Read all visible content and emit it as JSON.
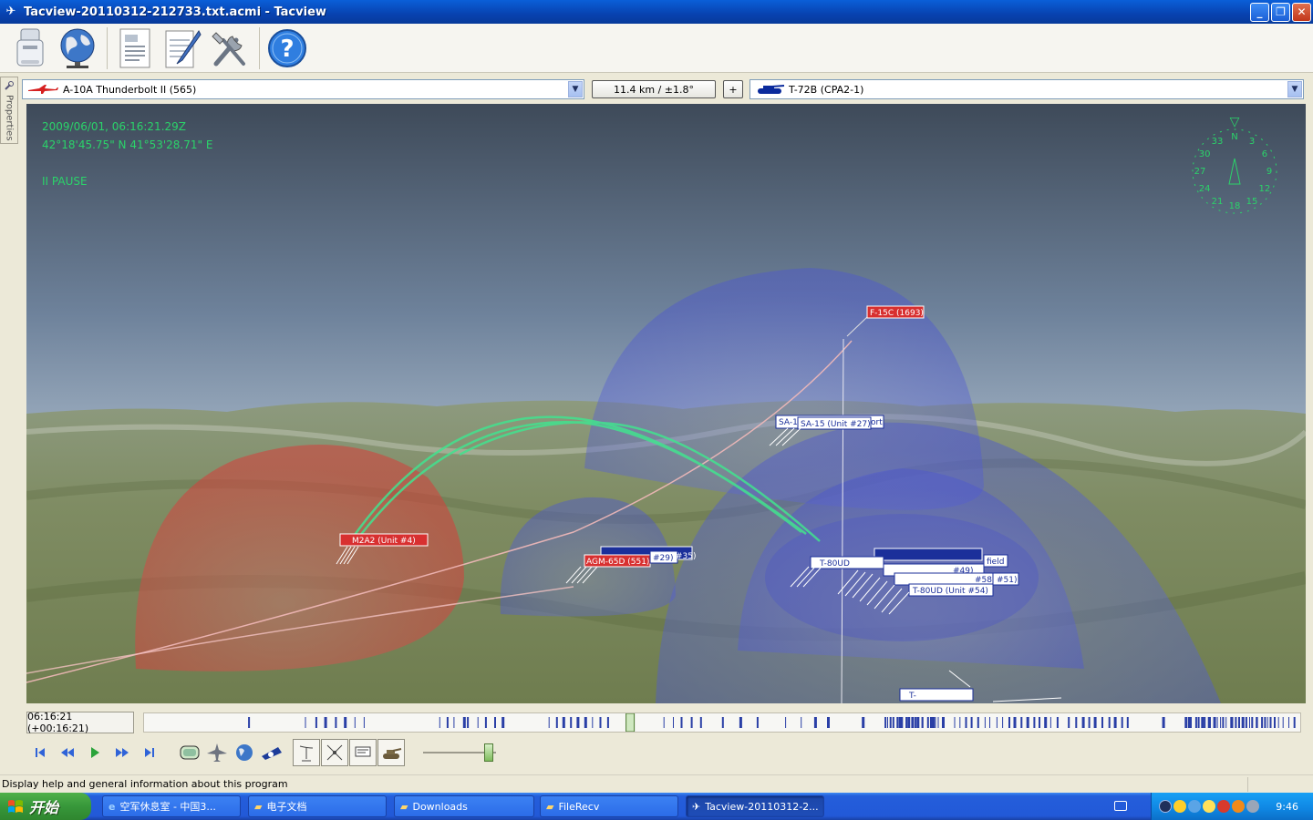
{
  "window": {
    "title": "Tacview-20110312-212733.txt.acmi - Tacview",
    "minimize": "_",
    "restore": "❐",
    "close": "✕"
  },
  "toolbar": {
    "items": [
      "usb-icon",
      "globe-icon",
      "document-icon",
      "notepad-icon",
      "tools-icon",
      "help-icon"
    ],
    "help_glyph": "?"
  },
  "side_panel": {
    "label": "Properties"
  },
  "selectors": {
    "primary_object": "A-10A Thunderbolt II (565)",
    "range_readout": "11.4 km / ±1.8°",
    "plus_label": "+",
    "secondary_object": "T-72B (CPA2-1)"
  },
  "hud": {
    "datetime": "2009/06/01, 06:16:21.29Z",
    "coordinates": "42°18'45.75\" N  41°53'28.71\" E",
    "state": "II PAUSE"
  },
  "compass": {
    "marks": [
      "3",
      "6",
      "9",
      "12",
      "15",
      "18",
      "21",
      "24",
      "27",
      "30",
      "33",
      "N"
    ],
    "pointer": "▽"
  },
  "scene_labels": {
    "f15c": "F-15C (1693)",
    "m2a2": "M2A2 (Unit #4)",
    "agm": "AGM-65D (551)",
    "agm_companion": "#29)",
    "agm_companion2": "#35)",
    "sa15_left": "SA-1",
    "sa15": "SA-15 (Unit #27)",
    "sa15_tail": "ort",
    "t80ud_a": "T-80UD",
    "field_tail": "field",
    "unit49": "#49)",
    "unit58": "#58)",
    "unit51": "#51)",
    "t80ud_b": "T-80UD (Unit #54)",
    "bottom_tag": "T-"
  },
  "timeline": {
    "time": "06:16:21 (+00:16:21)",
    "playhead_fraction": 0.42
  },
  "controls": {
    "playback": [
      "skip-start-icon",
      "rewind-icon",
      "play-icon",
      "fast-forward-icon",
      "skip-end-icon"
    ],
    "view_modes": [
      "cockpit-view-icon",
      "aircraft-view-icon",
      "globe-view-icon",
      "telescope-view-icon"
    ],
    "tools": [
      "radar-icon",
      "crosshair-icon",
      "tag-icon",
      "tank-icon"
    ],
    "speed_fraction": 0.85
  },
  "status_text": "Display help and general information about this program",
  "taskbar": {
    "start": "开始",
    "tasks": [
      "空军休息室 - 中国3...",
      "电子文档",
      "Downloads",
      "FileRecv",
      "Tacview-20110312-2..."
    ],
    "clock": "9:46"
  },
  "colors": {
    "hud_green": "#2bd36a",
    "red_dome": "#d44a48",
    "blue_dome": "#5a6ae0",
    "label_red": "#d83030",
    "label_blue": "#1b2f9a"
  }
}
